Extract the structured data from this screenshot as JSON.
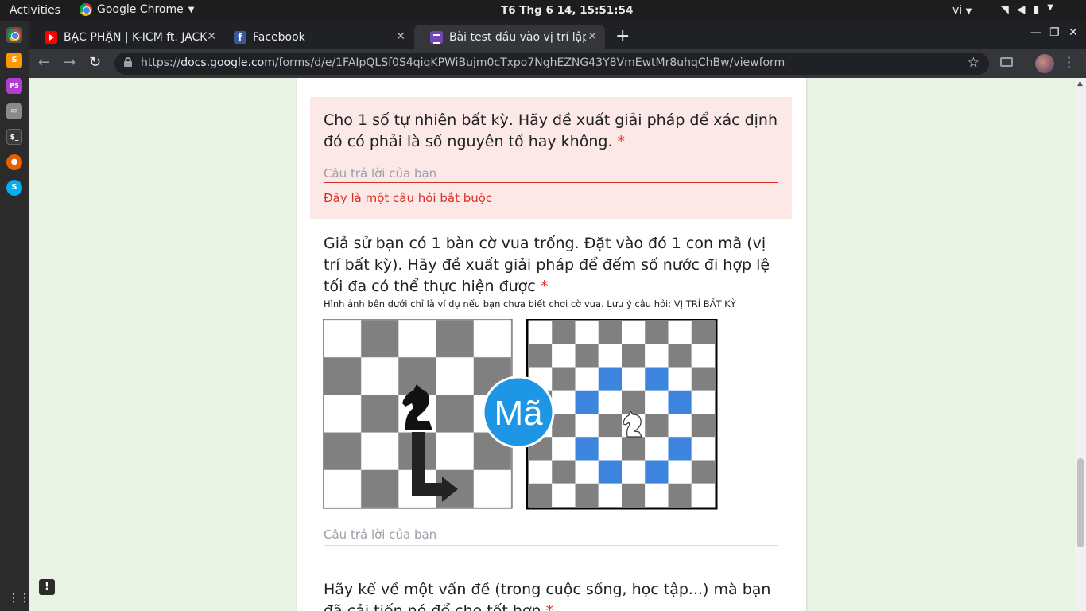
{
  "system": {
    "activities": "Activities",
    "app_name": "Google Chrome",
    "clock": "T6 Thg 6 14, 15:51:54",
    "language": "vi"
  },
  "browser": {
    "tabs": [
      {
        "title": "BẠC PHẬN | K-ICM ft. JACK",
        "icon": "youtube-icon"
      },
      {
        "title": "Facebook",
        "icon": "facebook-icon"
      },
      {
        "title": "Bài test đầu vào vị trí lập trình",
        "icon": "google-forms-icon"
      }
    ],
    "new_tab": "+",
    "url_scheme": "https://",
    "url_host": "docs.google.com",
    "url_path": "/forms/d/e/1FAIpQLSf0S4qiqKPWiBujm0cTxpo7NghEZNG43Y8VmEwtMr8uhqChBw/viewform"
  },
  "form": {
    "q1": {
      "title": "Cho 1 số tự nhiên bất kỳ. Hãy đề xuất giải pháp để xác định đó có phải là số nguyên tố hay không.",
      "required_mark": "*",
      "placeholder": "Câu trả lời của bạn",
      "error": "Đây là một câu hỏi bắt buộc"
    },
    "q2": {
      "title": "Giả sử bạn có 1 bàn cờ vua trống. Đặt vào đó 1 con mã (vị trí bất kỳ). Hãy đề xuất giải pháp để đếm số nước đi hợp lệ tối đa có thể thực hiện được",
      "required_mark": "*",
      "description": "Hình ảnh bên dưới chỉ là ví dụ nếu bạn chưa biết chơi cờ vua. Lưu ý câu hỏi: VỊ TRÍ BẤT KỲ",
      "image_badge": "Mã",
      "placeholder": "Câu trả lời của bạn"
    },
    "q3": {
      "title": "Hãy kể về một vấn đề (trong cuộc sống, học tập...) mà bạn đã cải tiến nó để cho tốt hơn",
      "required_mark": "*"
    }
  },
  "colors": {
    "error_red": "#d93025",
    "error_bg": "#fce8e6",
    "page_bg": "#e8f3e3",
    "badge_blue": "#1e96e6",
    "move_blue": "#3c84dc"
  }
}
